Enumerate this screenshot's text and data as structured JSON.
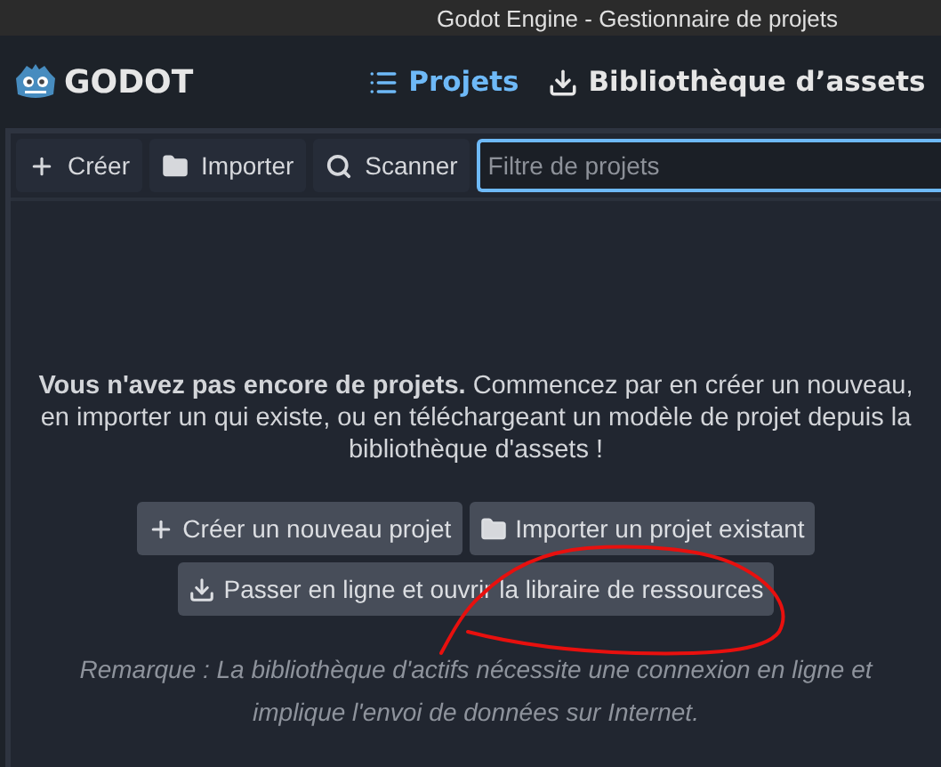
{
  "window": {
    "title": "Godot Engine - Gestionnaire de projets"
  },
  "header": {
    "logo": "GODOT",
    "tabs": [
      {
        "label": "Projets",
        "selected": true,
        "kind": "projects"
      },
      {
        "label": "Bibliothèque d’assets",
        "selected": false,
        "kind": "assets"
      }
    ]
  },
  "toolbar": {
    "buttons": [
      {
        "label": "Créer",
        "kind": "create"
      },
      {
        "label": "Importer",
        "kind": "import"
      },
      {
        "label": "Scanner",
        "kind": "scan"
      }
    ],
    "filter": {
      "placeholder": "Filtre de projets",
      "focused": true
    }
  },
  "empty_state": {
    "message": "**Vous n'avez pas encore de projets.** Commencez par en créer un nouveau, en importer un qui existe, ou en téléchargeant un modèle de projet depuis la bibliothèque d'assets !",
    "actions": [
      {
        "label": "Créer un nouveau projet",
        "kind": "create"
      },
      {
        "label": "Importer un projet existant",
        "kind": "import"
      },
      {
        "label": "Passer en ligne et ouvrir la libraire de ressources",
        "kind": "download"
      }
    ],
    "note": "Remarque : La bibliothèque d'actifs nécessite une connexion en ligne et implique l'envoi de données sur Internet."
  }
}
